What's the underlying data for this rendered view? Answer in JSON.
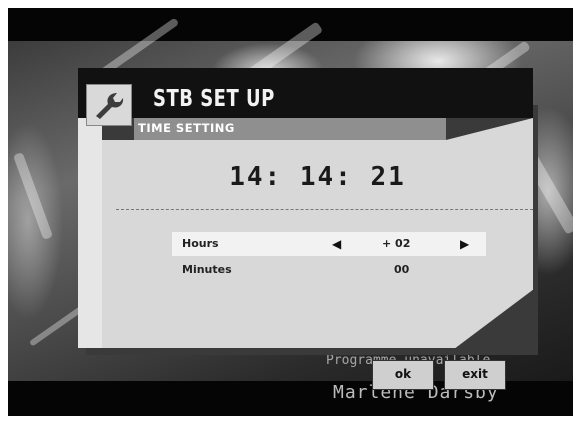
{
  "header": {
    "title": "STB SET UP",
    "icon": "wrench-icon"
  },
  "section": {
    "label": "TIME SETTING"
  },
  "clock": {
    "time": "14: 14: 21"
  },
  "rows": [
    {
      "label": "Hours",
      "value": "+ 02",
      "left_arrow": "◀",
      "right_arrow": "▶"
    },
    {
      "label": "Minutes",
      "value": "00"
    }
  ],
  "buttons": {
    "ok": "ok",
    "exit": "exit"
  },
  "background_text": {
    "line1": "Programme unavailable",
    "line2": "Marlene Darsby"
  }
}
